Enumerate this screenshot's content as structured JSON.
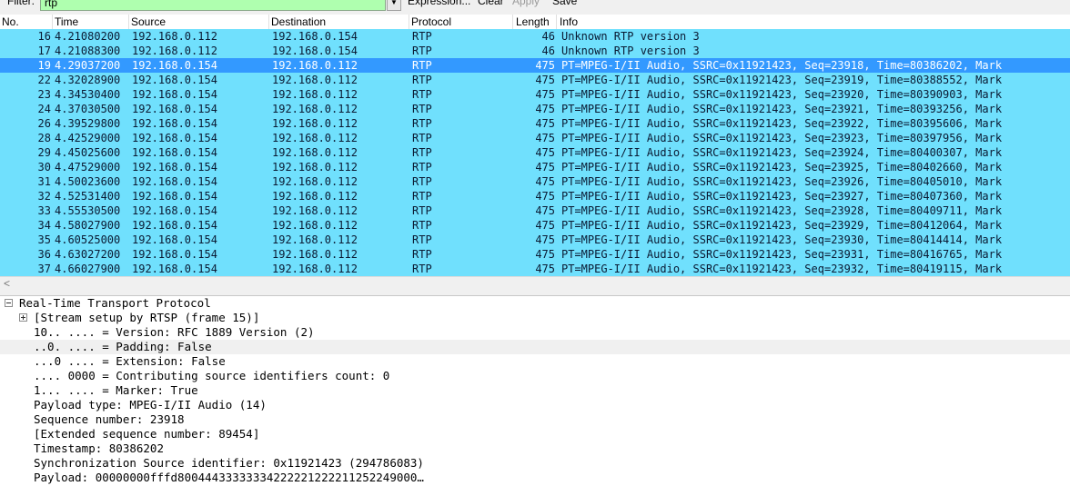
{
  "toolbar": {
    "filter_label": "Filter:",
    "filter_value": "rtp",
    "expression_label": "Expression...",
    "clear_label": "Clear",
    "apply_label": "Apply",
    "save_label": "Save",
    "filter_bg_color": "#afffaf"
  },
  "columns": {
    "no": "No.",
    "time": "Time",
    "source": "Source",
    "destination": "Destination",
    "protocol": "Protocol",
    "length": "Length",
    "info": "Info"
  },
  "packets": [
    {
      "no": "16",
      "time": "4.21080200",
      "src": "192.168.0.112",
      "dst": "192.168.0.154",
      "proto": "RTP",
      "len": "46",
      "info": "Unknown RTP version 3"
    },
    {
      "no": "17",
      "time": "4.21088300",
      "src": "192.168.0.112",
      "dst": "192.168.0.154",
      "proto": "RTP",
      "len": "46",
      "info": "Unknown RTP version 3"
    },
    {
      "no": "19",
      "time": "4.29037200",
      "src": "192.168.0.154",
      "dst": "192.168.0.112",
      "proto": "RTP",
      "len": "475",
      "info": "PT=MPEG-I/II Audio, SSRC=0x11921423, Seq=23918, Time=80386202, Mark",
      "selected": true
    },
    {
      "no": "22",
      "time": "4.32028900",
      "src": "192.168.0.154",
      "dst": "192.168.0.112",
      "proto": "RTP",
      "len": "475",
      "info": "PT=MPEG-I/II Audio, SSRC=0x11921423, Seq=23919, Time=80388552, Mark"
    },
    {
      "no": "23",
      "time": "4.34530400",
      "src": "192.168.0.154",
      "dst": "192.168.0.112",
      "proto": "RTP",
      "len": "475",
      "info": "PT=MPEG-I/II Audio, SSRC=0x11921423, Seq=23920, Time=80390903, Mark"
    },
    {
      "no": "24",
      "time": "4.37030500",
      "src": "192.168.0.154",
      "dst": "192.168.0.112",
      "proto": "RTP",
      "len": "475",
      "info": "PT=MPEG-I/II Audio, SSRC=0x11921423, Seq=23921, Time=80393256, Mark"
    },
    {
      "no": "26",
      "time": "4.39529800",
      "src": "192.168.0.154",
      "dst": "192.168.0.112",
      "proto": "RTP",
      "len": "475",
      "info": "PT=MPEG-I/II Audio, SSRC=0x11921423, Seq=23922, Time=80395606, Mark"
    },
    {
      "no": "28",
      "time": "4.42529000",
      "src": "192.168.0.154",
      "dst": "192.168.0.112",
      "proto": "RTP",
      "len": "475",
      "info": "PT=MPEG-I/II Audio, SSRC=0x11921423, Seq=23923, Time=80397956, Mark"
    },
    {
      "no": "29",
      "time": "4.45025600",
      "src": "192.168.0.154",
      "dst": "192.168.0.112",
      "proto": "RTP",
      "len": "475",
      "info": "PT=MPEG-I/II Audio, SSRC=0x11921423, Seq=23924, Time=80400307, Mark"
    },
    {
      "no": "30",
      "time": "4.47529000",
      "src": "192.168.0.154",
      "dst": "192.168.0.112",
      "proto": "RTP",
      "len": "475",
      "info": "PT=MPEG-I/II Audio, SSRC=0x11921423, Seq=23925, Time=80402660, Mark"
    },
    {
      "no": "31",
      "time": "4.50023600",
      "src": "192.168.0.154",
      "dst": "192.168.0.112",
      "proto": "RTP",
      "len": "475",
      "info": "PT=MPEG-I/II Audio, SSRC=0x11921423, Seq=23926, Time=80405010, Mark"
    },
    {
      "no": "32",
      "time": "4.52531400",
      "src": "192.168.0.154",
      "dst": "192.168.0.112",
      "proto": "RTP",
      "len": "475",
      "info": "PT=MPEG-I/II Audio, SSRC=0x11921423, Seq=23927, Time=80407360, Mark"
    },
    {
      "no": "33",
      "time": "4.55530500",
      "src": "192.168.0.154",
      "dst": "192.168.0.112",
      "proto": "RTP",
      "len": "475",
      "info": "PT=MPEG-I/II Audio, SSRC=0x11921423, Seq=23928, Time=80409711, Mark"
    },
    {
      "no": "34",
      "time": "4.58027900",
      "src": "192.168.0.154",
      "dst": "192.168.0.112",
      "proto": "RTP",
      "len": "475",
      "info": "PT=MPEG-I/II Audio, SSRC=0x11921423, Seq=23929, Time=80412064, Mark"
    },
    {
      "no": "35",
      "time": "4.60525000",
      "src": "192.168.0.154",
      "dst": "192.168.0.112",
      "proto": "RTP",
      "len": "475",
      "info": "PT=MPEG-I/II Audio, SSRC=0x11921423, Seq=23930, Time=80414414, Mark"
    },
    {
      "no": "36",
      "time": "4.63027200",
      "src": "192.168.0.154",
      "dst": "192.168.0.112",
      "proto": "RTP",
      "len": "475",
      "info": "PT=MPEG-I/II Audio, SSRC=0x11921423, Seq=23931, Time=80416765, Mark"
    },
    {
      "no": "37",
      "time": "4.66027900",
      "src": "192.168.0.154",
      "dst": "192.168.0.112",
      "proto": "RTP",
      "len": "475",
      "info": "PT=MPEG-I/II Audio, SSRC=0x11921423, Seq=23932, Time=80419115, Mark"
    }
  ],
  "row_color": "#70e0fd",
  "selected_color": "#3399ff",
  "details": [
    {
      "text": "Real-Time Transport Protocol",
      "level": 0,
      "expander": "minus"
    },
    {
      "text": "[Stream setup by RTSP (frame 15)]",
      "level": 1,
      "expander": "plus"
    },
    {
      "text": "10.. .... = Version: RFC 1889 Version (2)",
      "level": 2
    },
    {
      "text": "..0. .... = Padding: False",
      "level": 2,
      "highlight": true
    },
    {
      "text": "...0 .... = Extension: False",
      "level": 2
    },
    {
      "text": ".... 0000 = Contributing source identifiers count: 0",
      "level": 2
    },
    {
      "text": "1... .... = Marker: True",
      "level": 2
    },
    {
      "text": "Payload type: MPEG-I/II Audio (14)",
      "level": 2
    },
    {
      "text": "Sequence number: 23918",
      "level": 2
    },
    {
      "text": "[Extended sequence number: 89454]",
      "level": 2
    },
    {
      "text": "Timestamp: 80386202",
      "level": 2
    },
    {
      "text": "Synchronization Source identifier: 0x11921423 (294786083)",
      "level": 2
    },
    {
      "text": "Payload: 00000000fffd80044433333334222221222211252249000…",
      "level": 2
    }
  ]
}
